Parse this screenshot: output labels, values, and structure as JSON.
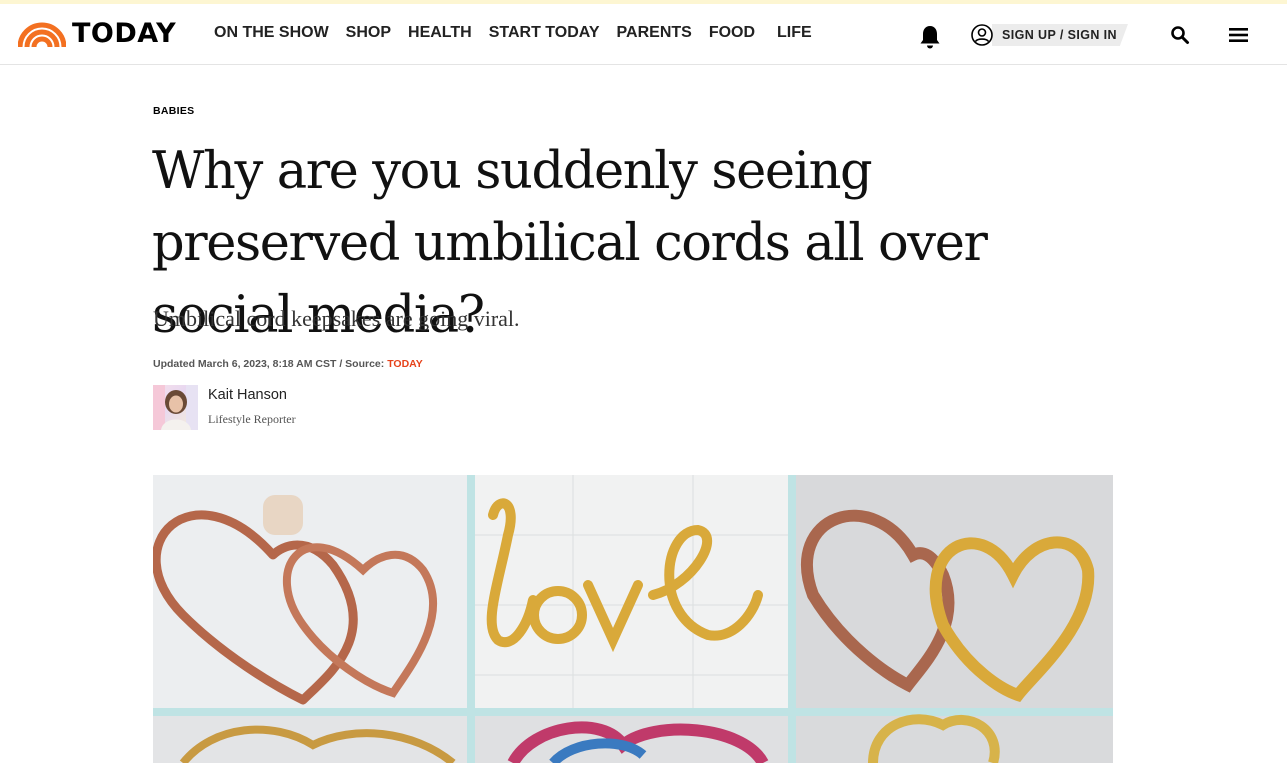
{
  "brand": {
    "name": "TODAY",
    "accent_color": "#e6421a",
    "logo_colors": [
      "#fcb711",
      "#f37021",
      "#cc004c",
      "#6460aa",
      "#0089d0",
      "#0db14b"
    ]
  },
  "nav": {
    "items": [
      {
        "label": "ON THE SHOW"
      },
      {
        "label": "SHOP"
      },
      {
        "label": "HEALTH"
      },
      {
        "label": "START TODAY"
      },
      {
        "label": "PARENTS"
      },
      {
        "label": "FOOD"
      },
      {
        "label": "LIFE"
      }
    ],
    "signup_label": "SIGN UP / SIGN IN",
    "icons": [
      "bell-icon",
      "user-circle-icon",
      "search-icon",
      "hamburger-menu-icon"
    ]
  },
  "article": {
    "eyebrow": "BABIES",
    "headline": "Why are you suddenly seeing preserved umbilical cords all over social media?",
    "dek": "Umbilical cord keepsakes are going viral.",
    "updated": "Updated March 6, 2023, 8:18 AM CST / Source: ",
    "source": "TODAY",
    "author": {
      "name": "Kait Hanson",
      "role": "Lifestyle Reporter"
    }
  },
  "hero_image": {
    "panel_background": "#cfe9ea",
    "metal_colors": [
      "#b5674a",
      "#d9a93a"
    ]
  }
}
